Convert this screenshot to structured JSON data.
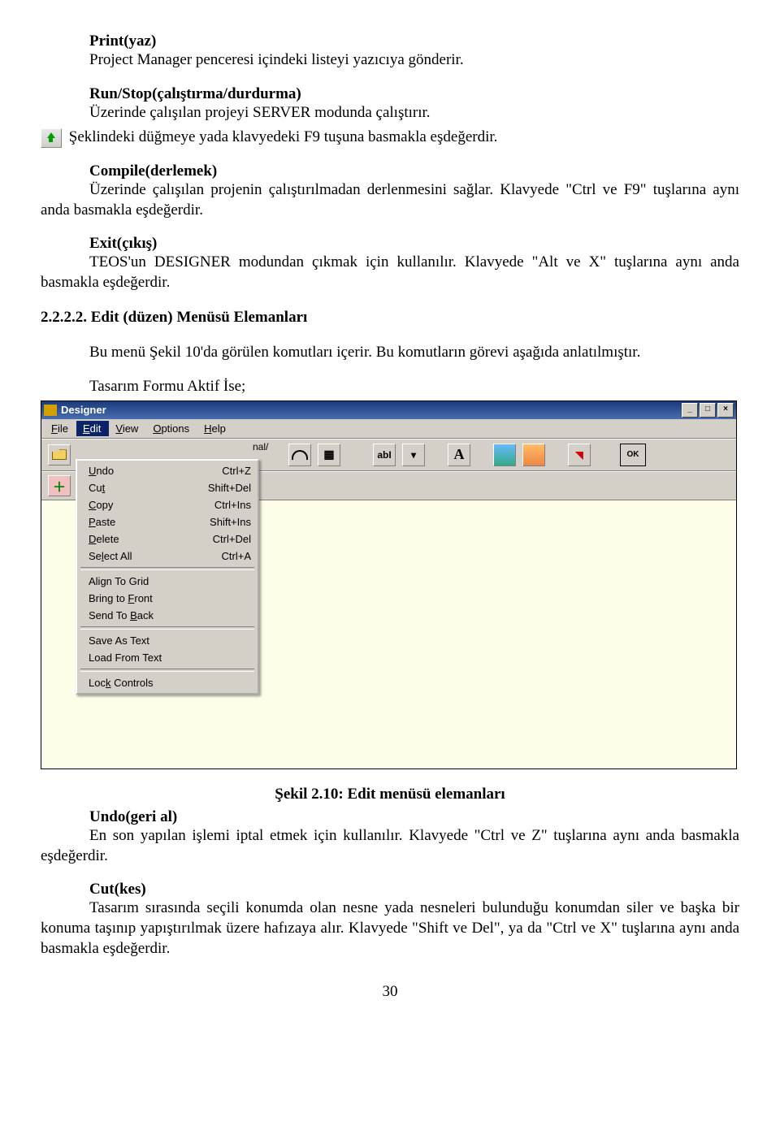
{
  "s1": {
    "title": "Print(yaz)",
    "body": "Project Manager penceresi içindeki listeyi yazıcıya gönderir."
  },
  "s2": {
    "title": "Run/Stop(çalıştırma/durdurma)",
    "body": "Üzerinde çalışılan projeyi SERVER modunda çalıştırır.",
    "body2": "Şeklindeki düğmeye yada klavyedeki F9 tuşuna basmakla eşdeğerdir."
  },
  "s3": {
    "title": "Compile(derlemek)",
    "body": "Üzerinde çalışılan projenin çalıştırılmadan derlenmesini sağlar. Klavyede \"Ctrl ve F9\" tuşlarına aynı anda basmakla eşdeğerdir."
  },
  "s4": {
    "title": "Exit(çıkış)",
    "body": "TEOS'un DESIGNER modundan çıkmak için kullanılır. Klavyede \"Alt ve X\" tuşlarına aynı anda basmakla eşdeğerdir."
  },
  "s5": {
    "title": "2.2.2.2. Edit (düzen) Menüsü Elemanları",
    "body": "Bu menü Şekil 10'da görülen komutları içerir. Bu komutların görevi aşağıda anlatılmıştır."
  },
  "s6": {
    "label": "Tasarım Formu Aktif İse;"
  },
  "designer": {
    "title": "Designer",
    "menus": {
      "file": "File",
      "edit": "Edit",
      "view": "View",
      "options": "Options",
      "help": "Help"
    },
    "winbtns": {
      "min": "_",
      "max": "□",
      "close": "×"
    },
    "tab_suffix": "nal",
    "edit_menu": [
      {
        "label": "Undo",
        "shortcut": "Ctrl+Z"
      },
      {
        "label": "Cut",
        "shortcut": "Shift+Del"
      },
      {
        "label": "Copy",
        "shortcut": "Ctrl+Ins"
      },
      {
        "label": "Paste",
        "shortcut": "Shift+Ins"
      },
      {
        "label": "Delete",
        "shortcut": "Ctrl+Del"
      },
      {
        "label": "Select All",
        "shortcut": "Ctrl+A"
      }
    ],
    "edit_menu2": [
      {
        "label": "Align To Grid"
      },
      {
        "label": "Bring to Front"
      },
      {
        "label": "Send To Back"
      }
    ],
    "edit_menu3": [
      {
        "label": "Save As Text"
      },
      {
        "label": "Load From Text"
      }
    ],
    "edit_menu4": [
      {
        "label": "Lock Controls"
      }
    ],
    "toolbar_glyphs": {
      "abi": "abI",
      "letter_a": "A",
      "ok": "OK"
    }
  },
  "figure_caption": "Şekil 2.10: Edit  menüsü elemanları",
  "s7": {
    "title": "Undo(geri al)",
    "body": "En son yapılan işlemi iptal etmek için kullanılır. Klavyede \"Ctrl ve Z\" tuşlarına aynı anda basmakla eşdeğerdir."
  },
  "s8": {
    "title": "Cut(kes)",
    "body": "Tasarım sırasında seçili konumda olan nesne yada nesneleri bulunduğu konumdan siler ve başka bir konuma taşınıp yapıştırılmak üzere hafızaya alır. Klavyede \"Shift ve Del\", ya da \"Ctrl ve X\" tuşlarına aynı anda basmakla eşdeğerdir."
  },
  "page_number": "30"
}
